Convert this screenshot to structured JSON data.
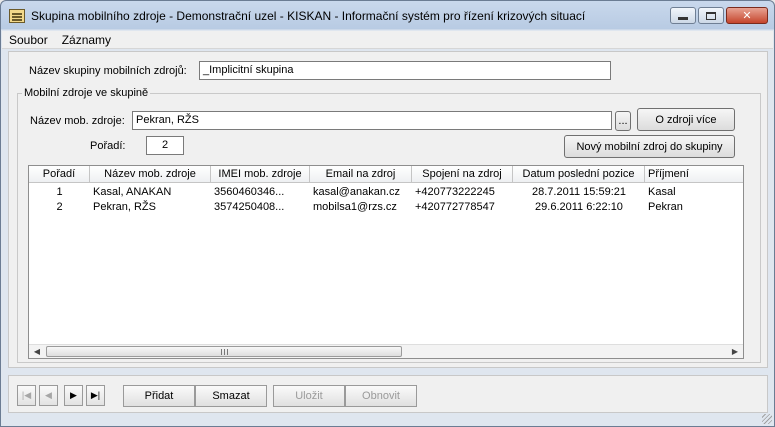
{
  "window": {
    "title": "Skupina mobilního zdroje - Demonstrační uzel - KISKAN - Informační systém pro řízení krizových situací",
    "icon": "form-window-icon"
  },
  "menu": [
    "Soubor",
    "Záznamy"
  ],
  "group_name": {
    "label": "Název skupiny mobilních zdrojů:",
    "value": "_Implicitní skupina"
  },
  "sources_group": {
    "title": "Mobilní zdroje ve skupině",
    "source_label": "Název mob. zdroje:",
    "source_value": "Pekran, RŽS",
    "browse_label": "...",
    "more_info_label": "O zdroji více",
    "order_label": "Pořadí:",
    "order_value": "2",
    "new_source_label": "Nový mobilní zdroj do skupiny"
  },
  "table": {
    "columns": [
      "Pořadí",
      "Název mob. zdroje",
      "IMEI mob. zdroje",
      "Email na zdroj",
      "Spojení na zdroj",
      "Datum poslední pozice",
      "Příjmení"
    ],
    "rows": [
      [
        "1",
        "Kasal, ANAKAN",
        "3560460346...",
        "kasal@anakan.cz",
        "+420773222245",
        "28.7.2011 15:59:21",
        "Kasal"
      ],
      [
        "2",
        "Pekran, RŽS",
        "3574250408...",
        "mobilsa1@rzs.cz",
        "+420772778547",
        "29.6.2011 6:22:10",
        "Pekran"
      ]
    ]
  },
  "nav": {
    "first": "first-record-icon",
    "prev": "previous-record-icon",
    "next": "next-record-icon",
    "last": "last-record-icon"
  },
  "actions": {
    "add": "Přidat",
    "delete": "Smazat",
    "save": "Uložit",
    "refresh": "Obnovit"
  }
}
